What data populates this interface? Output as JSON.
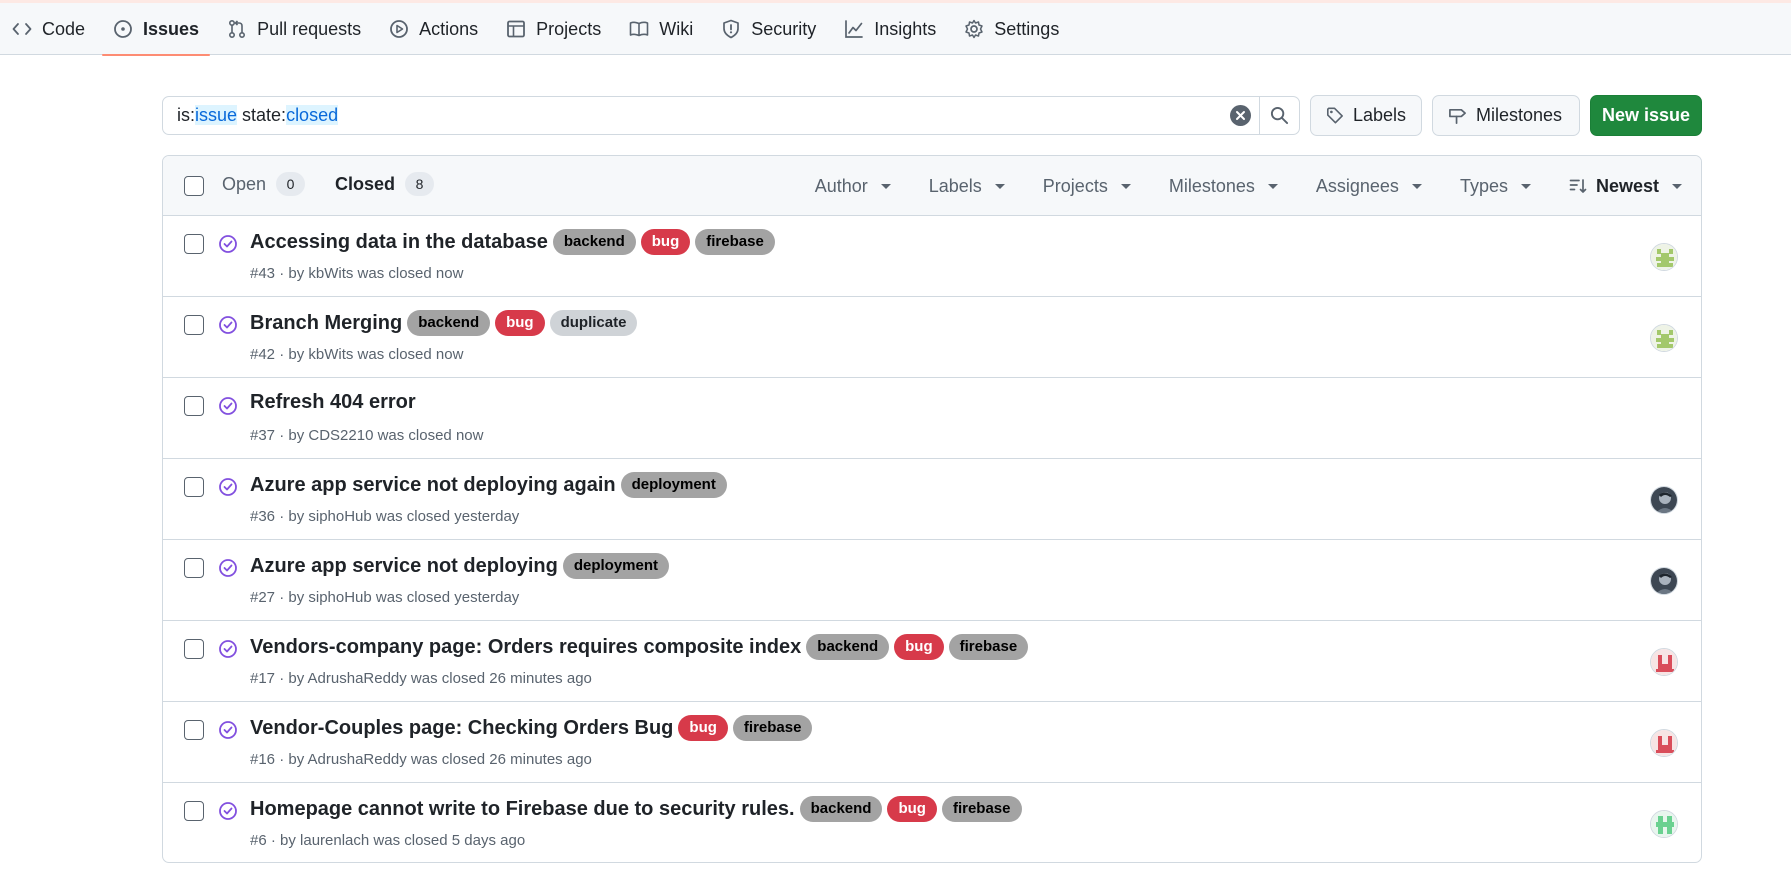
{
  "nav": {
    "tabs": [
      {
        "label": "Code",
        "icon": "code-icon",
        "active": false
      },
      {
        "label": "Issues",
        "icon": "issue-opened-icon",
        "active": true
      },
      {
        "label": "Pull requests",
        "icon": "git-pull-request-icon",
        "active": false
      },
      {
        "label": "Actions",
        "icon": "play-icon",
        "active": false
      },
      {
        "label": "Projects",
        "icon": "table-icon",
        "active": false
      },
      {
        "label": "Wiki",
        "icon": "book-icon",
        "active": false
      },
      {
        "label": "Security",
        "icon": "shield-icon",
        "active": false
      },
      {
        "label": "Insights",
        "icon": "graph-icon",
        "active": false
      },
      {
        "label": "Settings",
        "icon": "gear-icon",
        "active": false
      }
    ]
  },
  "search": {
    "q_is_prefix": "is:",
    "q_is_value": "issue",
    "q_state_prefix": " state:",
    "q_state_value": "closed"
  },
  "buttons": {
    "labels": "Labels",
    "milestones": "Milestones",
    "new_issue": "New issue"
  },
  "list_header": {
    "open_label": "Open",
    "open_count": "0",
    "closed_label": "Closed",
    "closed_count": "8",
    "filters": [
      "Author",
      "Labels",
      "Projects",
      "Milestones",
      "Assignees",
      "Types"
    ],
    "sort_label": "Newest"
  },
  "colors": {
    "closed_icon": "#8250df",
    "label_gray": "#a3a3a3",
    "label_light": "#cfd3d7",
    "label_red": "#d73a4a"
  },
  "issues": [
    {
      "title": "Accessing data in the database",
      "meta": "#43 · by kbWits was closed now",
      "labels": [
        {
          "text": "backend",
          "style": "gray"
        },
        {
          "text": "bug",
          "style": "red"
        },
        {
          "text": "firebase",
          "style": "gray"
        }
      ],
      "avatar": "green-identicon"
    },
    {
      "title": "Branch Merging",
      "meta": "#42 · by kbWits was closed now",
      "labels": [
        {
          "text": "backend",
          "style": "gray"
        },
        {
          "text": "bug",
          "style": "red"
        },
        {
          "text": "duplicate",
          "style": "light"
        }
      ],
      "avatar": "green-identicon"
    },
    {
      "title": "Refresh 404 error",
      "meta": "#37 · by CDS2210 was closed now",
      "labels": [],
      "avatar": "none"
    },
    {
      "title": "Azure app service not deploying again",
      "meta": "#36 · by siphoHub was closed yesterday",
      "labels": [
        {
          "text": "deployment",
          "style": "gray"
        }
      ],
      "avatar": "photo"
    },
    {
      "title": "Azure app service not deploying",
      "meta": "#27 · by siphoHub was closed yesterday",
      "labels": [
        {
          "text": "deployment",
          "style": "gray"
        }
      ],
      "avatar": "photo"
    },
    {
      "title": "Vendors-company page: Orders requires composite index",
      "meta": "#17 · by AdrushaReddy was closed 26 minutes ago",
      "labels": [
        {
          "text": "backend",
          "style": "gray"
        },
        {
          "text": "bug",
          "style": "red"
        },
        {
          "text": "firebase",
          "style": "gray"
        }
      ],
      "avatar": "red-identicon"
    },
    {
      "title": "Vendor-Couples page: Checking Orders Bug",
      "meta": "#16 · by AdrushaReddy was closed 26 minutes ago",
      "labels": [
        {
          "text": "bug",
          "style": "red"
        },
        {
          "text": "firebase",
          "style": "gray"
        }
      ],
      "avatar": "red-identicon"
    },
    {
      "title": "Homepage cannot write to Firebase due to security rules.",
      "meta": "#6 · by laurenlach was closed 5 days ago",
      "labels": [
        {
          "text": "backend",
          "style": "gray"
        },
        {
          "text": "bug",
          "style": "red"
        },
        {
          "text": "firebase",
          "style": "gray"
        }
      ],
      "avatar": "mint-identicon"
    }
  ]
}
